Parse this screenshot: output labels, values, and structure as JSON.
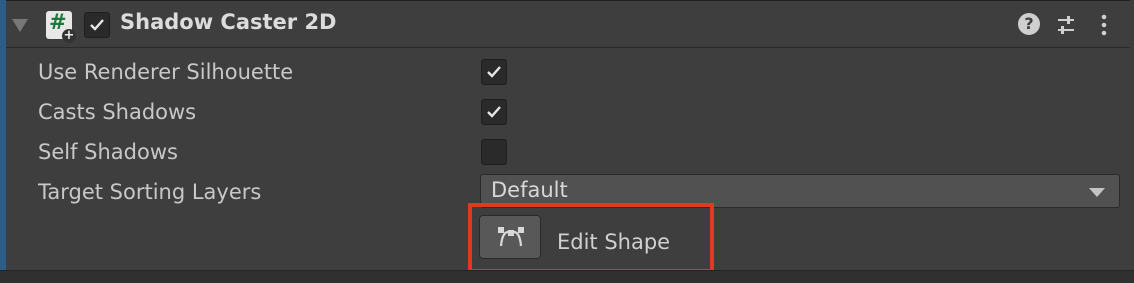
{
  "component": {
    "title": "Shadow Caster 2D",
    "enabled": true
  },
  "properties": [
    {
      "label": "Use Renderer Silhouette",
      "checked": true
    },
    {
      "label": "Casts Shadows",
      "checked": true
    },
    {
      "label": "Self Shadows",
      "checked": false
    }
  ],
  "target_sorting_layers": {
    "label": "Target Sorting Layers",
    "value": "Default"
  },
  "edit_shape": {
    "label": "Edit Shape"
  },
  "header_icons": [
    "help-icon",
    "preset-icon",
    "kebab-menu-icon"
  ],
  "colors": {
    "accent": "#2c5d87",
    "highlight": "#e03a22",
    "script_hash": "#1b7a3b"
  }
}
